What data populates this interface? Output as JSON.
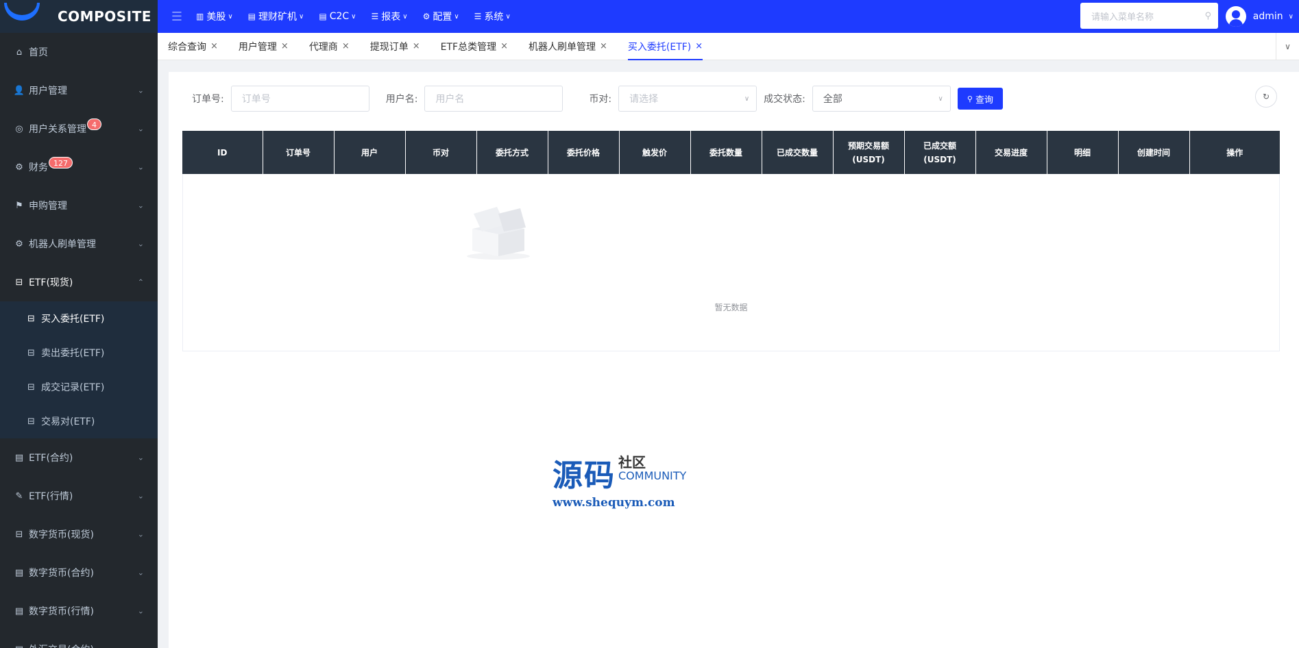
{
  "app": {
    "logo_text": "COMPOSITE"
  },
  "sidebar": {
    "items": [
      {
        "label": "首页",
        "icon": "home-icon"
      },
      {
        "label": "用户管理",
        "icon": "user-icon"
      },
      {
        "label": "用户关系管理",
        "icon": "user-circle-icon",
        "badge": "4"
      },
      {
        "label": "财务",
        "icon": "gear-icon",
        "badge": "127"
      },
      {
        "label": "申购管理",
        "icon": "subscribe-icon"
      },
      {
        "label": "机器人刷单管理",
        "icon": "gear-icon"
      },
      {
        "label": "ETF(现货)",
        "icon": "store-icon"
      },
      {
        "label": "ETF(合约)",
        "icon": "doc-icon"
      },
      {
        "label": "ETF(行情)",
        "icon": "edit-icon"
      },
      {
        "label": "数字货币(现货)",
        "icon": "store-icon"
      },
      {
        "label": "数字货币(合约)",
        "icon": "doc-icon"
      },
      {
        "label": "数字货币(行情)",
        "icon": "doc-icon"
      },
      {
        "label": "外汇交易(合约)",
        "icon": "doc-icon"
      }
    ],
    "etf_sub": [
      {
        "label": "买入委托(ETF)"
      },
      {
        "label": "卖出委托(ETF)"
      },
      {
        "label": "成交记录(ETF)"
      },
      {
        "label": "交易对(ETF)"
      }
    ]
  },
  "topbar": {
    "menus": [
      {
        "label": "美股",
        "icon": "bar-chart-icon"
      },
      {
        "label": "理财矿机",
        "icon": "list-icon"
      },
      {
        "label": "C2C",
        "icon": "list-icon"
      },
      {
        "label": "报表",
        "icon": "list-icon"
      },
      {
        "label": "配置",
        "icon": "gear-icon"
      },
      {
        "label": "系统",
        "icon": "list-icon"
      }
    ],
    "search_placeholder": "请输入菜单名称",
    "username": "admin"
  },
  "tabs": [
    {
      "label": "综合查询"
    },
    {
      "label": "用户管理"
    },
    {
      "label": "代理商"
    },
    {
      "label": "提现订单"
    },
    {
      "label": "ETF总类管理"
    },
    {
      "label": "机器人刷单管理"
    },
    {
      "label": "买入委托(ETF)"
    }
  ],
  "filters": {
    "order_label": "订单号:",
    "order_placeholder": "订单号",
    "user_label": "用户名:",
    "user_placeholder": "用户名",
    "pair_label": "币对:",
    "pair_placeholder": "请选择",
    "status_label": "成交状态:",
    "status_value": "全部",
    "query_button": "查询"
  },
  "table": {
    "columns": [
      "ID",
      "订单号",
      "用户",
      "币对",
      "委托方式",
      "委托价格",
      "触发价",
      "委托数量",
      "已成交数量",
      "预期交易额(USDT)",
      "已成交额(USDT)",
      "交易进度",
      "明细",
      "创建时间",
      "操作"
    ],
    "empty_text": "暂无数据"
  },
  "watermark": {
    "zh": "源码",
    "she": "社区",
    "community": "COMMUNITY",
    "url": "www.shequym.com"
  },
  "colors": {
    "topbar": "#1e3bff",
    "sidebar": "#23282d",
    "table_header": "#2a3541",
    "badge": "#f56c6c"
  }
}
